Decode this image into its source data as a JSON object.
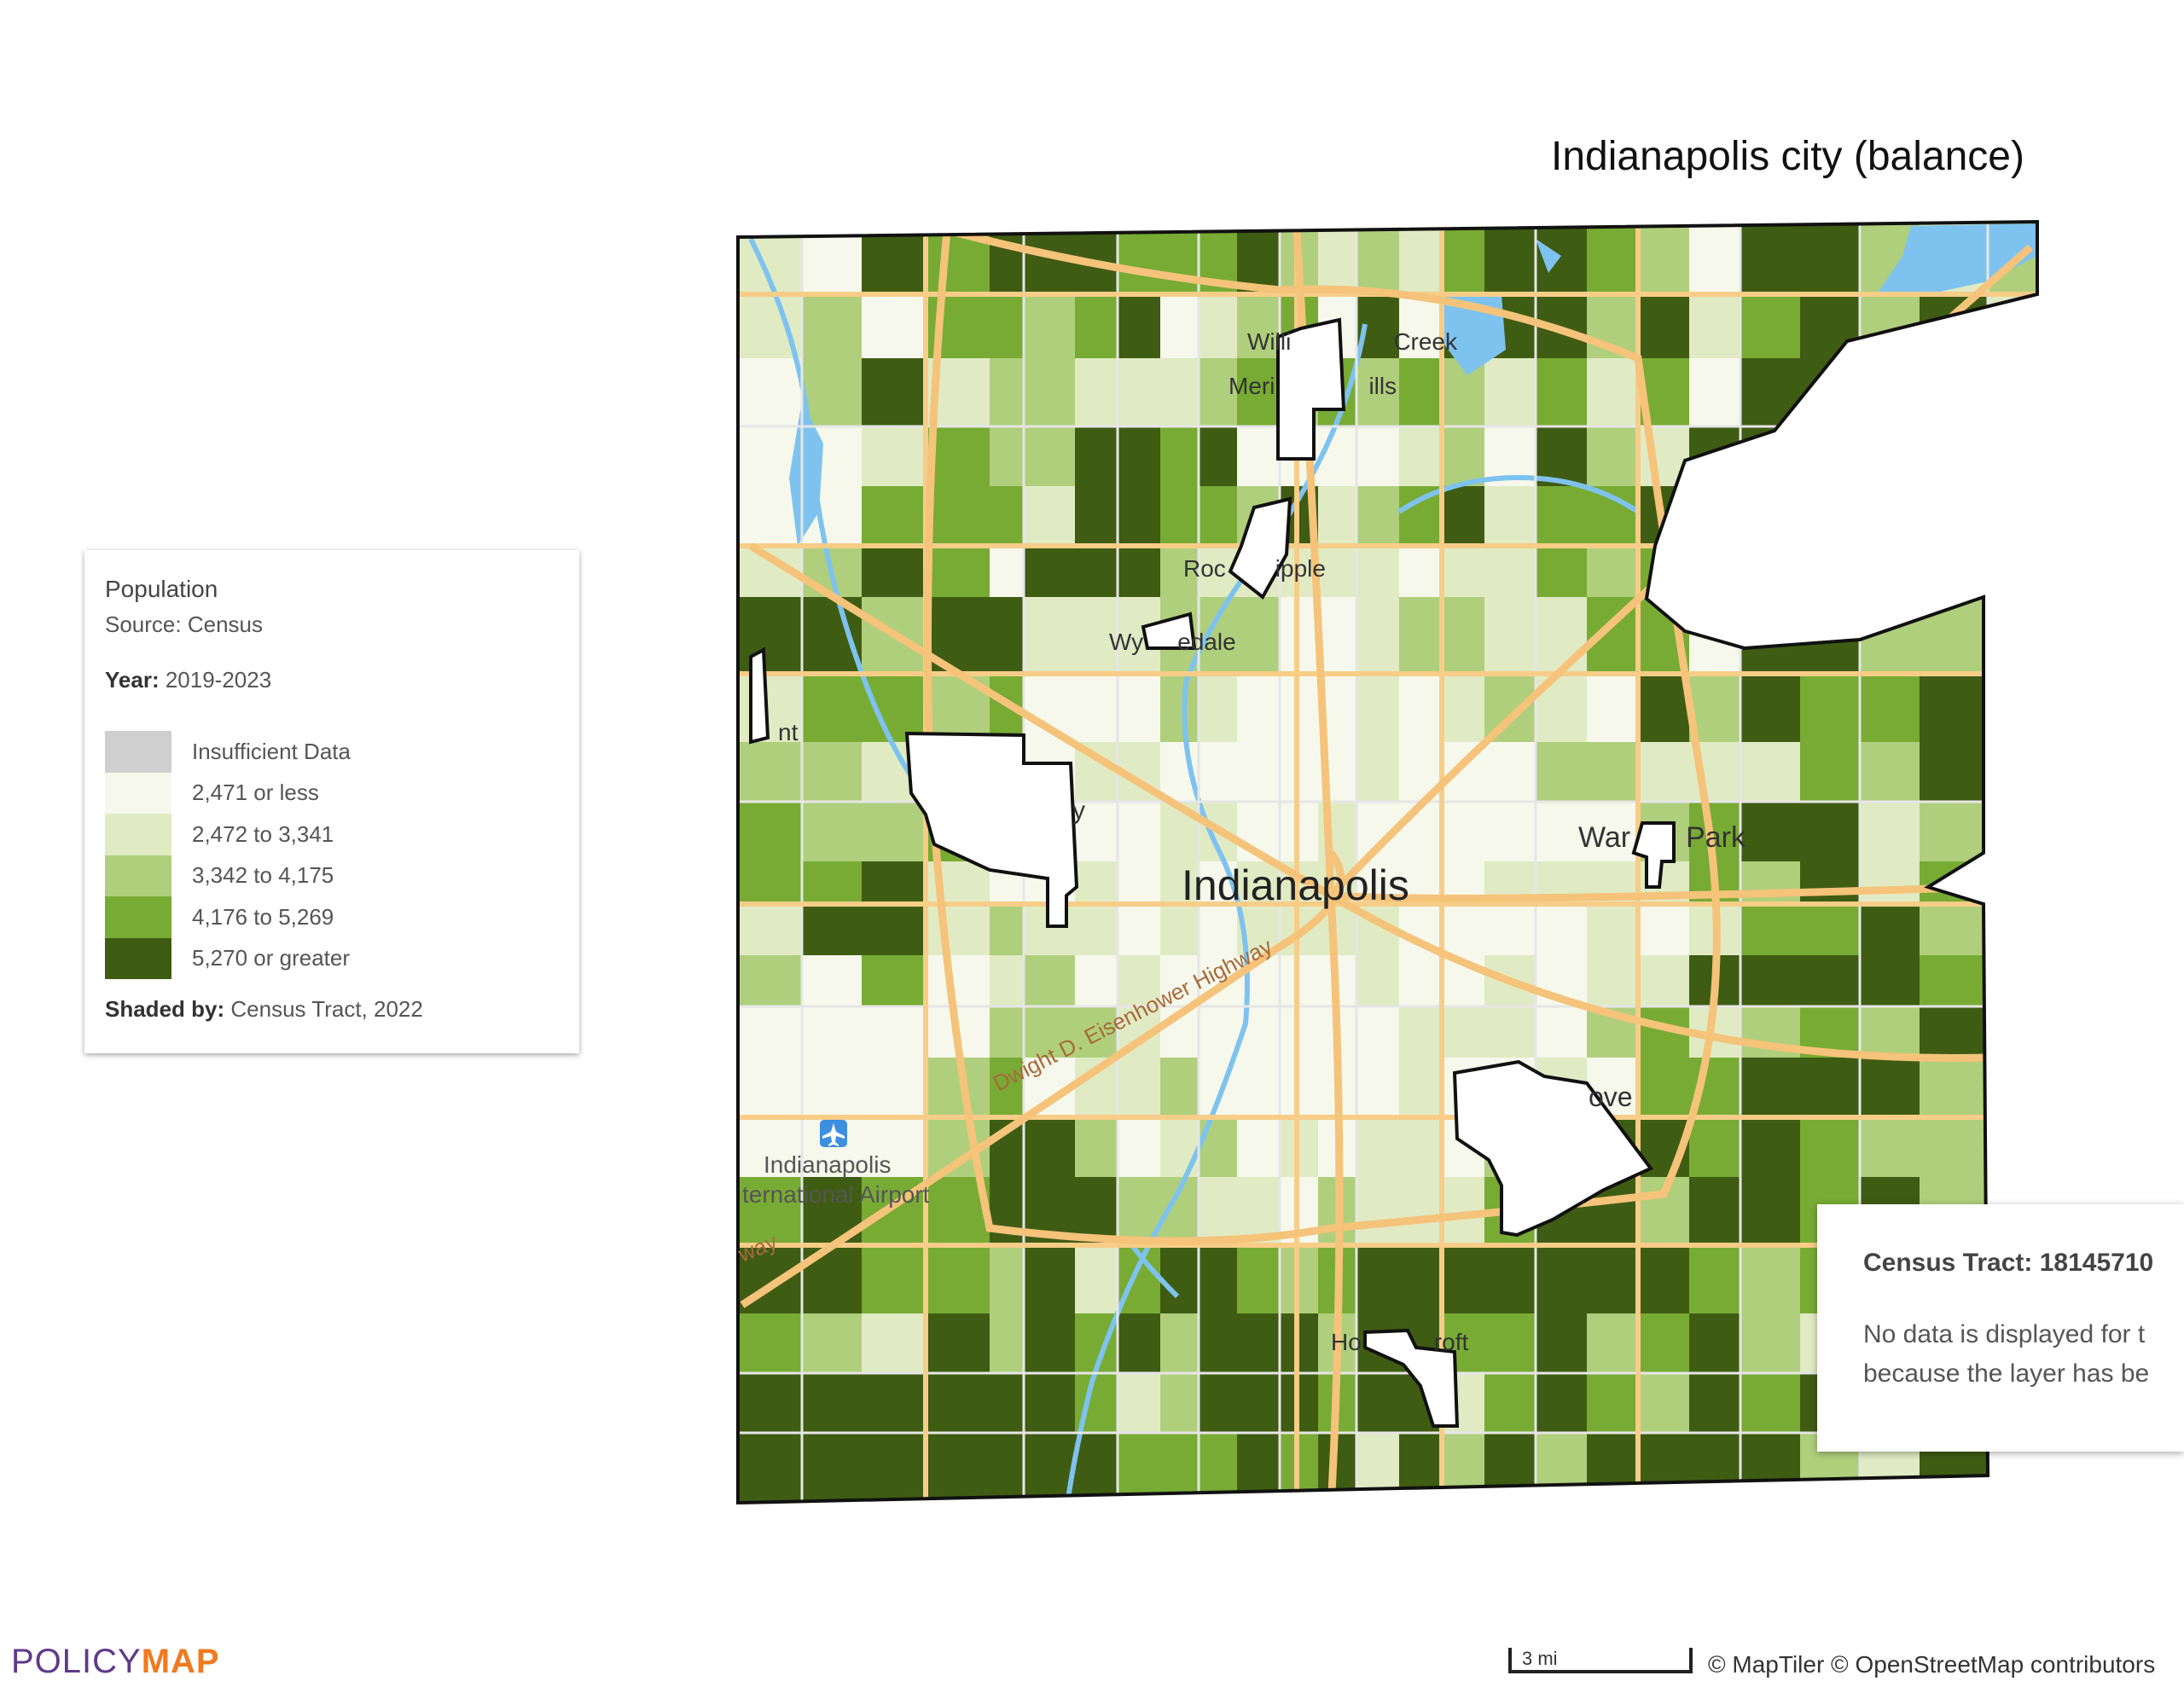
{
  "map": {
    "title": "Indianapolis city (balance)",
    "city_label": "Indianapolis",
    "places": [
      {
        "name": "Williams Creek"
      },
      {
        "name": "Meridian Hills"
      },
      {
        "name": "Rocky Ripple"
      },
      {
        "name": "Wynnedale"
      },
      {
        "name": "Warren Park"
      },
      {
        "name": "Beech Grove"
      },
      {
        "name": "Homecroft"
      },
      {
        "name": "Speedway"
      },
      {
        "name": "Clermont"
      },
      {
        "name": "Indianapolis International Airport"
      }
    ],
    "road_label": "Dwight D. Eisenhower Highway",
    "airport_icon": "airplane-icon"
  },
  "legend": {
    "title": "Population",
    "source": "Source: Census",
    "year_label": "Year:",
    "year_value": "2019-2023",
    "items": [
      {
        "label": "Insufficient Data",
        "color": "#cfcfcf"
      },
      {
        "label": "2,471 or less",
        "color": "#f6f8ec"
      },
      {
        "label": "2,472 to 3,341",
        "color": "#e0ebc4"
      },
      {
        "label": "3,342 to 4,175",
        "color": "#b0cf7c"
      },
      {
        "label": "4,176 to 5,269",
        "color": "#78ab34"
      },
      {
        "label": "5,270 or greater",
        "color": "#3f5c13"
      }
    ],
    "shaded_label": "Shaded by:",
    "shaded_value": "Census Tract, 2022"
  },
  "tooltip": {
    "title": "Census Tract: 18145710",
    "message_line1": "No data is displayed for t",
    "message_line2": "because the layer has be"
  },
  "footer": {
    "logo_part1": "POLICY",
    "logo_part2": "MAP",
    "scale_label": "3 mi",
    "attribution": "© MapTiler © OpenStreetMap contributors"
  }
}
